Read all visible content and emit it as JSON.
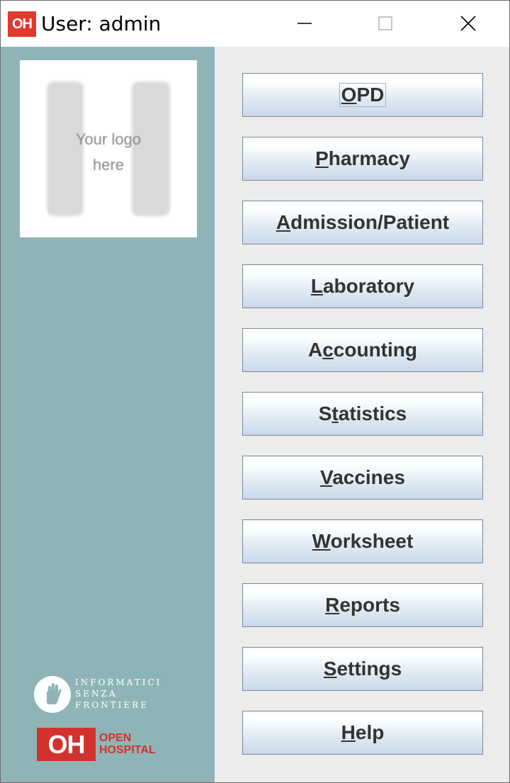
{
  "window": {
    "app_icon_text": "OH",
    "title": "User: admin"
  },
  "logo": {
    "line1": "Your logo",
    "line2": "here"
  },
  "sponsors": {
    "isf_line1": "INFORMATICI",
    "isf_line2": "SENZA",
    "isf_line3": "FRONTIERE",
    "oh_mark": "OH",
    "oh_line1": "OPEN",
    "oh_line2": "HOSPITAL"
  },
  "menu": [
    {
      "label": "OPD",
      "mnemonic_index": 0
    },
    {
      "label": "Pharmacy",
      "mnemonic_index": 0
    },
    {
      "label": "Admission/Patient",
      "mnemonic_index": 0
    },
    {
      "label": "Laboratory",
      "mnemonic_index": 0
    },
    {
      "label": "Accounting",
      "mnemonic_index": 1
    },
    {
      "label": "Statistics",
      "mnemonic_index": 1
    },
    {
      "label": "Vaccines",
      "mnemonic_index": 0
    },
    {
      "label": "Worksheet",
      "mnemonic_index": 0
    },
    {
      "label": "Reports",
      "mnemonic_index": 0
    },
    {
      "label": "Settings",
      "mnemonic_index": 0
    },
    {
      "label": "Help",
      "mnemonic_index": 0
    }
  ],
  "colors": {
    "left_panel": "#8fb4b7",
    "content_bg": "#ececec",
    "brand_red": "#d2322d"
  }
}
